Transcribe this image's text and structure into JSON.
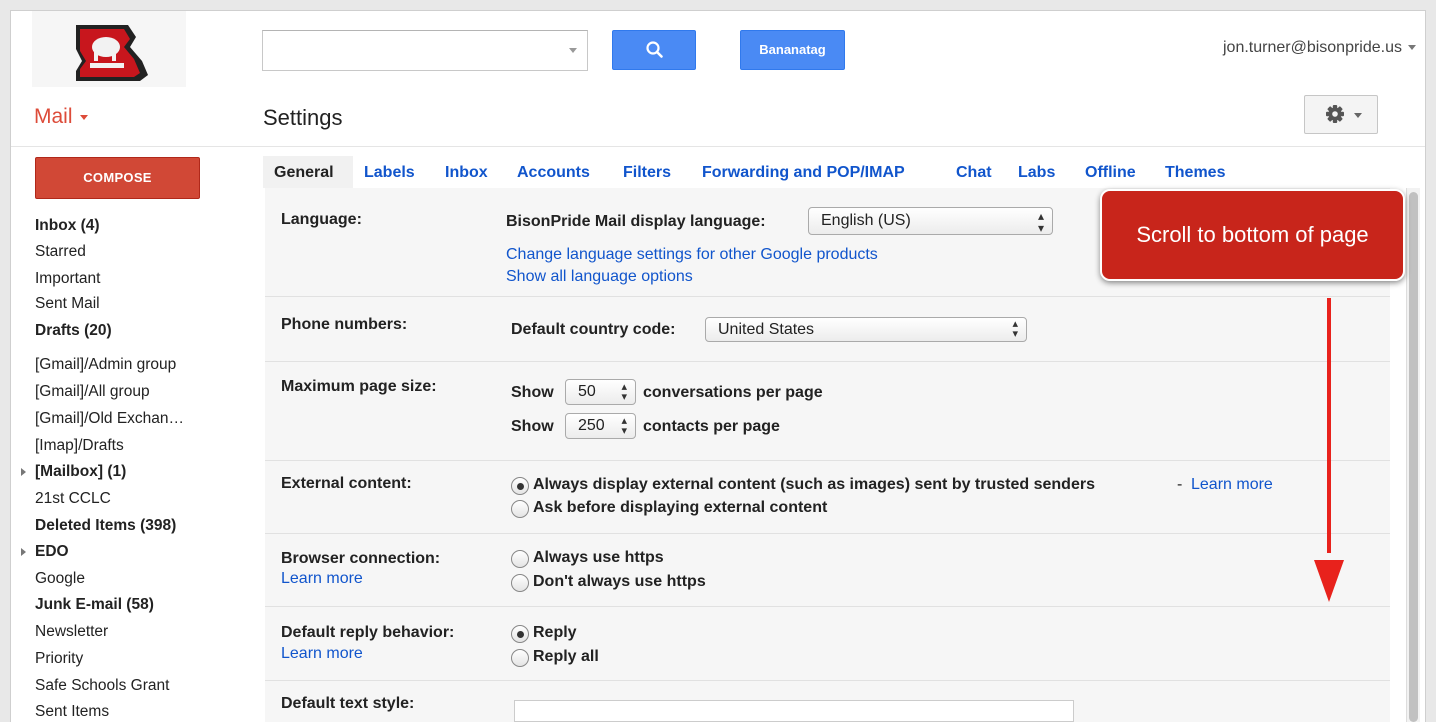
{
  "header": {
    "search_placeholder": "",
    "bananatag_label": "Bananatag",
    "account_email": "jon.turner@bisonpride.us"
  },
  "app": {
    "mail_label": "Mail",
    "page_title": "Settings"
  },
  "sidebar": {
    "compose_label": "COMPOSE",
    "items": [
      {
        "label": "Inbox (4)",
        "bold": true
      },
      {
        "label": "Starred",
        "bold": false
      },
      {
        "label": "Important",
        "bold": false
      },
      {
        "label": "Sent Mail",
        "bold": false
      },
      {
        "label": "Drafts (20)",
        "bold": true
      },
      {
        "label": "[Gmail]/Admin group",
        "bold": false
      },
      {
        "label": "[Gmail]/All group",
        "bold": false
      },
      {
        "label": "[Gmail]/Old Exchan…",
        "bold": false
      },
      {
        "label": "[Imap]/Drafts",
        "bold": false
      },
      {
        "label": "[Mailbox] (1)",
        "bold": true,
        "expandable": true
      },
      {
        "label": "21st CCLC",
        "bold": false
      },
      {
        "label": "Deleted Items (398)",
        "bold": true
      },
      {
        "label": "EDO",
        "bold": true,
        "expandable": true
      },
      {
        "label": "Google",
        "bold": false
      },
      {
        "label": "Junk E-mail (58)",
        "bold": true
      },
      {
        "label": "Newsletter",
        "bold": false
      },
      {
        "label": "Priority",
        "bold": false
      },
      {
        "label": "Safe Schools Grant",
        "bold": false
      },
      {
        "label": "Sent Items",
        "bold": false
      }
    ]
  },
  "tabs": [
    "General",
    "Labels",
    "Inbox",
    "Accounts",
    "Filters",
    "Forwarding and POP/IMAP",
    "Chat",
    "Labs",
    "Offline",
    "Themes"
  ],
  "active_tab": "General",
  "settings": {
    "language": {
      "label": "Language:",
      "display_label": "BisonPride Mail display language:",
      "value": "English (US)",
      "link1": "Change language settings for other Google products",
      "link2": "Show all language options"
    },
    "phone": {
      "label": "Phone numbers:",
      "country_label": "Default country code:",
      "value": "United States"
    },
    "page_size": {
      "label": "Maximum page size:",
      "show": "Show",
      "conversations_value": "50",
      "conversations_suffix": "conversations per page",
      "contacts_value": "250",
      "contacts_suffix": "contacts per page"
    },
    "external": {
      "label": "External content:",
      "option1": "Always display external content (such as images) sent by trusted senders",
      "dash": "-",
      "learn_more": "Learn more",
      "option2": "Ask before displaying external content",
      "selected": 1
    },
    "browser": {
      "label": "Browser connection:",
      "learn_more": "Learn more",
      "option1": "Always use https",
      "option2": "Don't always use https",
      "selected": 0
    },
    "reply": {
      "label": "Default reply behavior:",
      "learn_more": "Learn more",
      "option1": "Reply",
      "option2": "Reply all",
      "selected": 1
    },
    "text_style": {
      "label": "Default text style:"
    }
  },
  "annotation": {
    "callout_text": "Scroll to bottom of page",
    "color": "#c8251b"
  },
  "colors": {
    "link": "#1155cc",
    "compose": "#d14836",
    "search_button": "#4a8af4"
  }
}
